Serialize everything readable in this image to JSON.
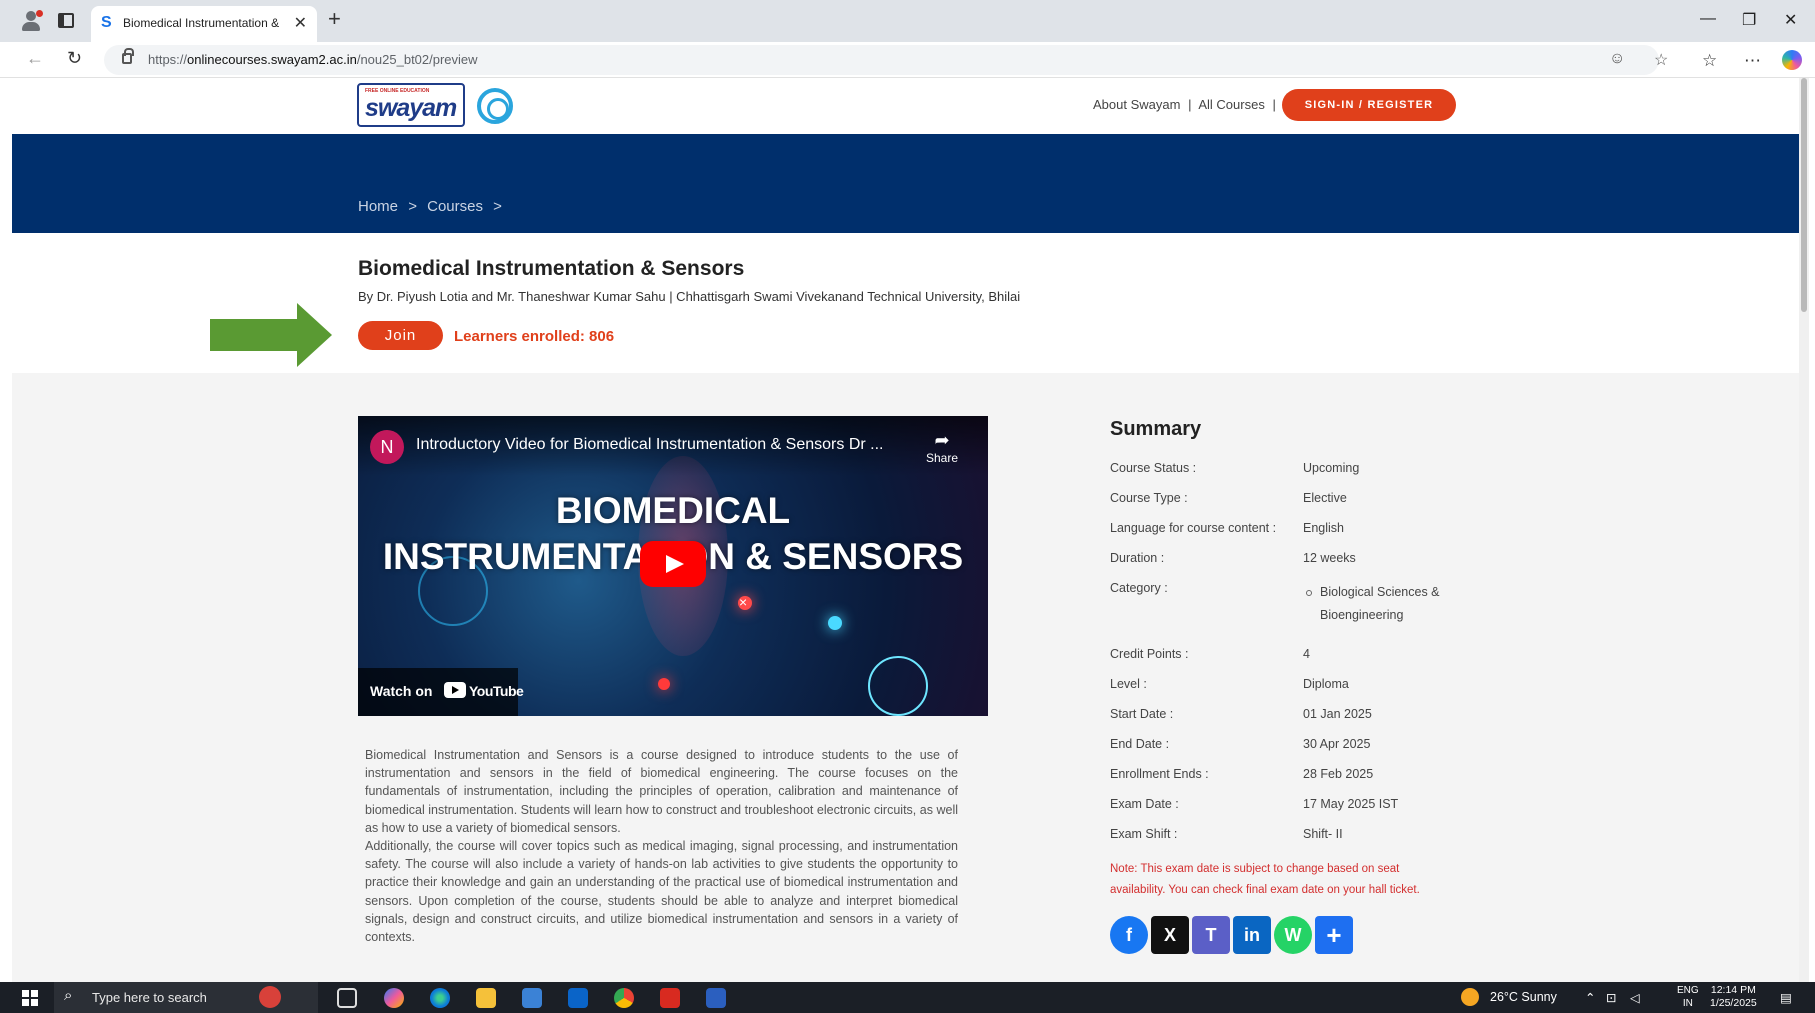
{
  "browser": {
    "tab_title": "Biomedical Instrumentation & Sensors",
    "url_prefix": "https://",
    "url_domain": "onlinecourses.swayam2.ac.in",
    "url_path": "/nou25_bt02/preview"
  },
  "site": {
    "logo_text": "swayam",
    "logo_tagline": "FREE ONLINE EDUCATION",
    "nav_about": "About Swayam",
    "nav_sep": "|",
    "nav_all_courses": "All Courses",
    "signin_label": "SIGN-IN / REGISTER"
  },
  "breadcrumb": {
    "home": "Home",
    "sep1": ">",
    "courses": "Courses",
    "sep2": ">"
  },
  "course": {
    "title": "Biomedical Instrumentation & Sensors",
    "byline": "By Dr. Piyush Lotia and Mr. Thaneshwar Kumar Sahu   |   Chhattisgarh Swami Vivekanand Technical University, Bhilai",
    "join_label": "Join",
    "enrolled": "Learners enrolled: 806"
  },
  "video": {
    "channel_initial": "N",
    "title": "Introductory Video for Biomedical Instrumentation & Sensors Dr ...",
    "share_label": "Share",
    "overlay_line1": "BIOMEDICAL",
    "overlay_line2": "INSTRUMENTATION & SENSORS",
    "watch_on": "Watch on",
    "youtube": "YouTube"
  },
  "description": {
    "p1": "Biomedical Instrumentation and Sensors is a course designed to introduce students to the use of instrumentation and sensors in the field of biomedical engineering. The course focuses on the fundamentals of instrumentation, including the principles of operation, calibration and maintenance of biomedical instrumentation. Students will learn how to construct and troubleshoot electronic circuits, as well as how to use a variety of biomedical sensors.",
    "p2": "Additionally, the course will cover topics such as medical imaging, signal processing, and instrumentation safety. The course will also include a variety of hands-on lab activities to give students the opportunity to practice their knowledge and gain an understanding of the practical use of biomedical instrumentation and sensors. Upon completion of the course, students should be able to analyze and interpret biomedical signals, design and construct circuits, and utilize biomedical instrumentation and sensors in a variety of contexts."
  },
  "summary": {
    "heading": "Summary",
    "rows": [
      {
        "k": "Course Status :",
        "v": "Upcoming"
      },
      {
        "k": "Course Type :",
        "v": "Elective"
      },
      {
        "k": "Language for course content :",
        "v": "English"
      },
      {
        "k": "Duration :",
        "v": "12 weeks"
      },
      {
        "k": "Category :",
        "v": "Biological Sciences & Bioengineering"
      },
      {
        "k": "Credit Points :",
        "v": "4"
      },
      {
        "k": "Level :",
        "v": "Diploma"
      },
      {
        "k": "Start Date :",
        "v": "01 Jan 2025"
      },
      {
        "k": "End Date :",
        "v": "30 Apr 2025"
      },
      {
        "k": "Enrollment Ends :",
        "v": "28 Feb 2025"
      },
      {
        "k": "Exam Date :",
        "v": "17 May 2025 IST"
      },
      {
        "k": "Exam Shift :",
        "v": "Shift- II"
      }
    ],
    "note": "Note: This exam date is subject to change based on seat availability. You can check final exam date on your hall ticket.",
    "share_buttons": [
      {
        "name": "facebook",
        "glyph": "f",
        "color": "#1877f2"
      },
      {
        "name": "x",
        "glyph": "X",
        "color": "#111111"
      },
      {
        "name": "teams",
        "glyph": "T",
        "color": "#5b5fc7"
      },
      {
        "name": "linkedin",
        "glyph": "in",
        "color": "#0a66c2"
      },
      {
        "name": "whatsapp",
        "glyph": "W",
        "color": "#25d366"
      },
      {
        "name": "share",
        "glyph": "+",
        "color": "#1e6ff1"
      }
    ]
  },
  "taskbar": {
    "search_placeholder": "Type here to search",
    "weather": "26°C  Sunny",
    "lang1": "ENG",
    "lang2": "IN",
    "time": "12:14 PM",
    "date": "1/25/2025"
  }
}
